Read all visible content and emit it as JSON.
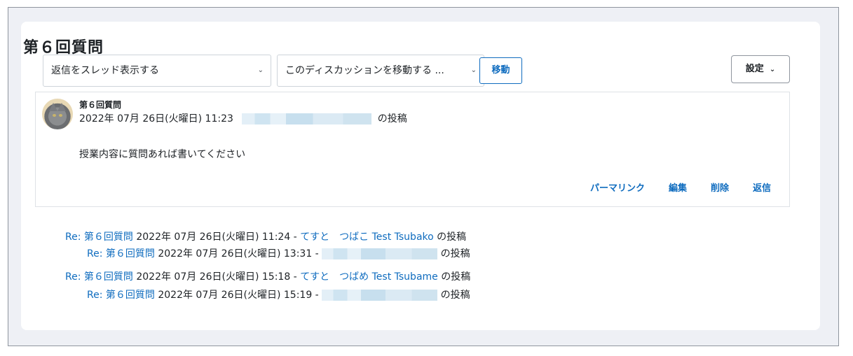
{
  "discussion": {
    "title": "第６回質問",
    "display_mode": "返信をスレッド表示する",
    "move_select": "このディスカッションを移動する ...",
    "move_button": "移動",
    "settings_button": "設定"
  },
  "post": {
    "subject": "第６回質問",
    "date": "2022年 07月 26日(火曜日) 11:23",
    "posted_by_suffix": "の投稿",
    "body": "授業内容に質問あれば書いてください",
    "actions": {
      "permalink": "パーマリンク",
      "edit": "編集",
      "delete": "削除",
      "reply": "返信"
    }
  },
  "replies": [
    {
      "subject": "Re: 第６回質問",
      "date": "2022年 07月 26日(火曜日) 11:24 -",
      "author": "てすと　つばこ Test Tsubako",
      "suffix": "の投稿"
    },
    {
      "subject": "Re: 第６回質問",
      "date": "2022年 07月 26日(火曜日) 13:31 -",
      "author": "",
      "suffix": "の投稿"
    },
    {
      "subject": "Re: 第６回質問",
      "date": "2022年 07月 26日(火曜日) 15:18 -",
      "author": "てすと　つばめ Test Tsubame",
      "suffix": "の投稿"
    },
    {
      "subject": "Re: 第６回質問",
      "date": "2022年 07月 26日(火曜日) 15:19 -",
      "author": "",
      "suffix": "の投稿"
    }
  ],
  "icons": {
    "select_chevron": "chevron-down-icon",
    "avatar": "cat-avatar"
  },
  "colors": {
    "link": "#0f6cbf",
    "text": "#1d2125",
    "page_bg": "#eef0f5"
  }
}
